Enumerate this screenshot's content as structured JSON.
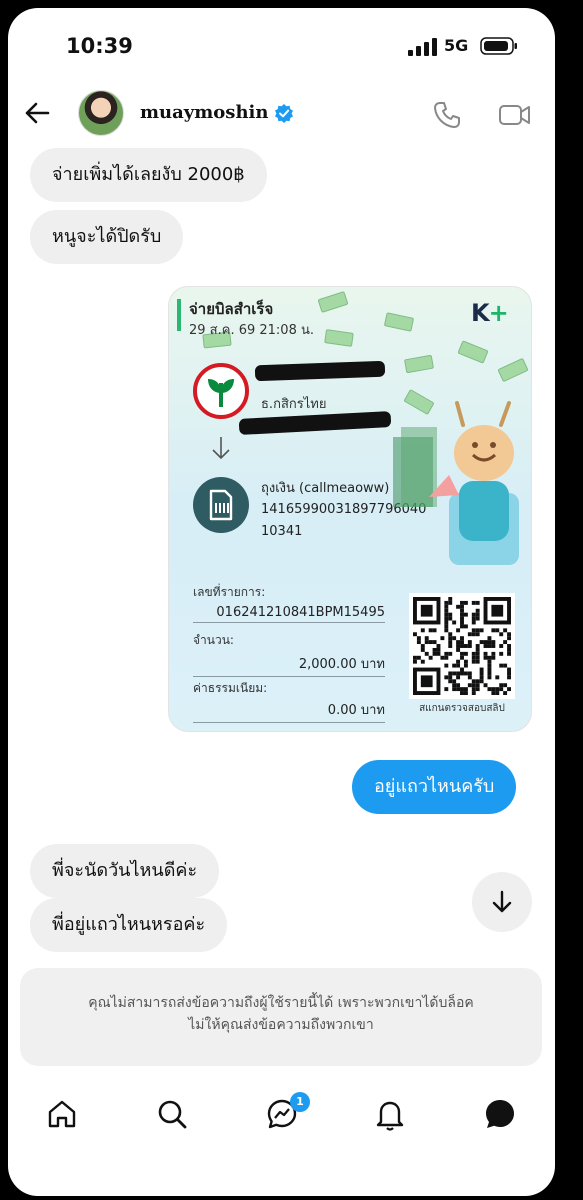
{
  "status_bar": {
    "time": "10:39",
    "network": "5G"
  },
  "header": {
    "username": "muaymoshin"
  },
  "messages": [
    {
      "text": "จ่ายเพิ่มได้เลยงับ 2000฿",
      "sender": "them"
    },
    {
      "text": "หนูจะได้ปิดรับ",
      "sender": "them"
    },
    {
      "text": "อยู่แถวไหนครับ",
      "sender": "me"
    },
    {
      "text": "พี่จะนัดวันไหนดีค่ะ",
      "sender": "them"
    },
    {
      "text": "พี่อยู่แถวไหนหรอค่ะ",
      "sender": "them"
    }
  ],
  "receipt": {
    "title": "จ่ายบิลสำเร็จ",
    "datetime": "29 ส.ค. 69  21:08 น.",
    "brand": "K",
    "brand_plus": "+",
    "bank_name": "ธ.กสิกรไทย",
    "recipient_name": "ถุงเงิน (callmeaoww)",
    "recipient_account": "1416599003189779604010341",
    "txn_label": "เลขที่รายการ:",
    "txn_value": "016241210841BPM15495",
    "amount_label": "จำนวน:",
    "amount_value": "2,000.00 บาท",
    "fee_label": "ค่าธรรมเนียม:",
    "fee_value": "0.00 บาท",
    "scan_label": "สแกนตรวจสอบสลิป",
    "accent_color": "#2bb673",
    "bank_color": "#d41b23"
  },
  "notice": {
    "line1": "คุณไม่สามารถส่งข้อความถึงผู้ใช้รายนี้ได้ เพราะพวกเขาได้บล็อค",
    "line2": "ไม่ให้คุณส่งข้อความถึงพวกเขา"
  },
  "nav": {
    "items": [
      "home-icon",
      "search-icon",
      "messages-icon",
      "notifications-icon",
      "chat-icon"
    ],
    "messages_badge": "1"
  },
  "colors": {
    "accent": "#1d9bf0",
    "bubble_other": "#efefef"
  }
}
